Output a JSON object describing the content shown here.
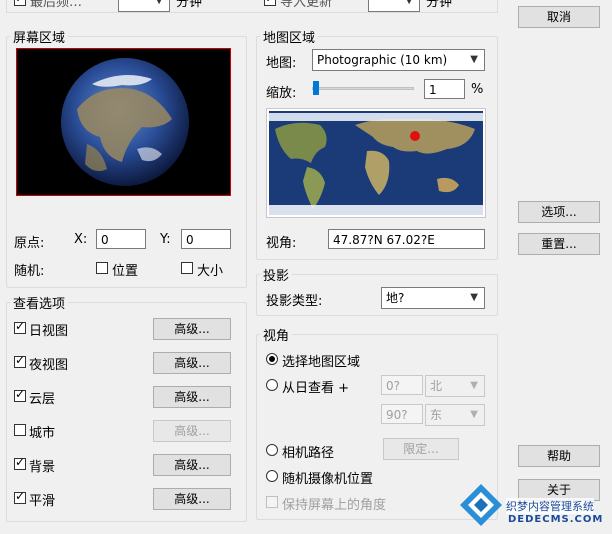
{
  "top": {
    "left_label": "最后频…",
    "left_unit": "分钟",
    "right_label": "导入更新",
    "right_unit": "分钟"
  },
  "screen_area": {
    "title": "屏幕区域",
    "origin_label": "原点:",
    "x_label": "X:",
    "x_value": "0",
    "y_label": "Y:",
    "y_value": "0",
    "random_label": "随机:",
    "position_label": "位置",
    "size_label": "大小"
  },
  "view_options": {
    "title": "查看选项",
    "items": [
      {
        "label": "日视图",
        "checked": true,
        "button": "高级...",
        "enabled": true
      },
      {
        "label": "夜视图",
        "checked": true,
        "button": "高级...",
        "enabled": true
      },
      {
        "label": "云层",
        "checked": true,
        "button": "高级...",
        "enabled": true
      },
      {
        "label": "城市",
        "checked": false,
        "button": "高级...",
        "enabled": false
      },
      {
        "label": "背景",
        "checked": true,
        "button": "高级...",
        "enabled": true
      },
      {
        "label": "平滑",
        "checked": true,
        "button": "高级...",
        "enabled": true
      }
    ]
  },
  "map_area": {
    "title": "地图区域",
    "map_label": "地图:",
    "map_value": "Photographic (10 km)",
    "zoom_label": "缩放:",
    "zoom_value": "1",
    "zoom_unit": "%",
    "zoom_fraction": 0.01,
    "viewpoint_label": "视角:",
    "viewpoint_value": "47.87?N   67.02?E"
  },
  "projection": {
    "title": "投影",
    "type_label": "投影类型:",
    "type_value": "地?"
  },
  "viewpoint": {
    "title": "视角",
    "opt_map": "选择地图区域",
    "opt_sun": "从日查看 +",
    "sun_deg1": "0?",
    "sun_dir1": "北",
    "sun_deg2": "90?",
    "sun_dir2": "东",
    "opt_camera": "相机路径",
    "limit_button": "限定...",
    "opt_random": "随机摄像机位置",
    "keep_angle": "保持屏幕上的角度"
  },
  "side_buttons": {
    "cancel": "取消",
    "options": "选项...",
    "reset": "重置...",
    "help": "帮助",
    "close": "关于"
  },
  "watermark": {
    "line1": "织梦内容管理系统",
    "line2": "DEDECMS.COM"
  },
  "colors": {
    "marker": "#e01010",
    "globe_border": "#cc0000",
    "accent": "#0078d7"
  }
}
